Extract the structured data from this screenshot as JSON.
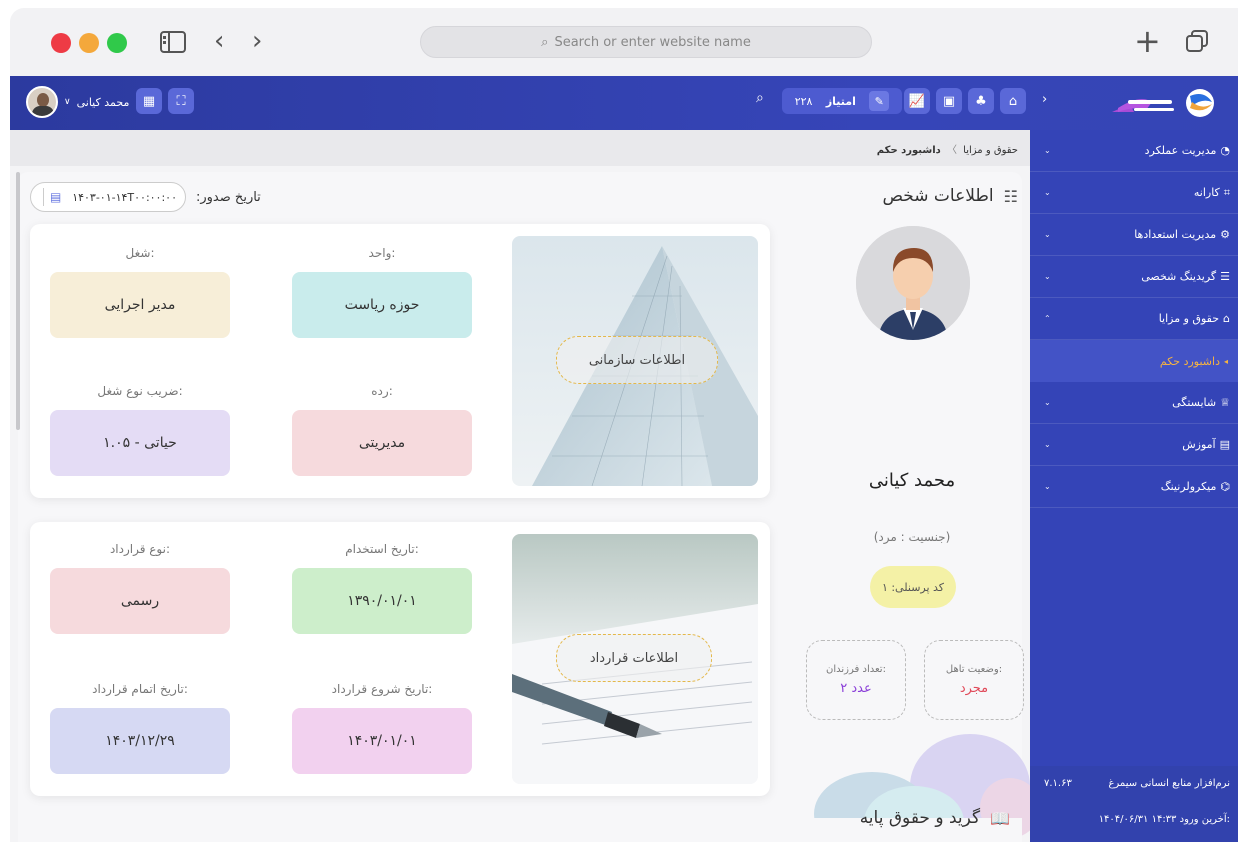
{
  "browser": {
    "address_placeholder": "Search or enter website name"
  },
  "topbar": {
    "user_name": "محمد کیانی",
    "user_chevron": "∨",
    "score_label": "امتیاز",
    "score_value": "۲۲۸"
  },
  "sidebar": {
    "items": [
      {
        "label": "مدیریت عملکرد",
        "arrow": "⌄",
        "icon": "gauge-icon"
      },
      {
        "label": "کارانه",
        "arrow": "⌄",
        "icon": "grid-icon"
      },
      {
        "label": "مدیریت استعدادها",
        "arrow": "⌄",
        "icon": "talent-icon"
      },
      {
        "label": "گریدینگ شخصی",
        "arrow": "⌄",
        "icon": "grading-icon"
      },
      {
        "label": "حقوق و مزایا",
        "arrow": "⌃",
        "icon": "salary-icon"
      },
      {
        "label": "شایستگی",
        "arrow": "⌄",
        "icon": "competency-icon"
      },
      {
        "label": "آموزش",
        "arrow": "⌄",
        "icon": "book-icon"
      },
      {
        "label": "میکرولرنینگ",
        "arrow": "⌄",
        "icon": "cap-icon"
      }
    ],
    "sub_item": "داشبورد حکم",
    "footer": {
      "product": "نرم‌افزار منابع انسانی سیمرغ",
      "version": "۷.۱.۶۳",
      "login_label": "آخرین ورود:",
      "login_value": "۱۴۰۴/۰۶/۳۱ ۱۴:۳۳"
    }
  },
  "breadcrumb": {
    "parent": "حقوق و مزایا",
    "separator": "〉",
    "current": "داشبورد حکم"
  },
  "person": {
    "section_title": "اطلاعات شخص",
    "name": "محمد کیانی",
    "gender": "(جنسیت : مرد)",
    "personnel_code": "کد پرسنلی: ۱",
    "marital_label": "وضعیت تاهل:",
    "marital_value": "مجرد",
    "children_label": "تعداد فرزندان:",
    "children_value": "۲ عدد"
  },
  "issue_date": {
    "label": "تاریخ صدور:",
    "value": "۱۴۰۳-۰۱-۱۴T۰۰:۰۰:۰۰"
  },
  "org_card": {
    "image_label": "اطلاعات سازمانی",
    "unit_label": "واحد:",
    "unit_value": "حوزه ریاست",
    "job_label": "شغل:",
    "job_value": "مدیر اجرایی",
    "rank_label": "رده:",
    "rank_value": "مدیریتی",
    "coef_label": "ضریب نوع شغل:",
    "coef_value": "حیاتی - ۱.۰۵"
  },
  "contract_card": {
    "image_label": "اطلاعات قرارداد",
    "hire_label": "تاریخ استخدام:",
    "hire_value": "۱۳۹۰/۰۱/۰۱",
    "type_label": "نوع قرارداد:",
    "type_value": "رسمی",
    "start_label": "تاریخ شروع قرارداد:",
    "start_value": "۱۴۰۳/۰۱/۰۱",
    "end_label": "تاریخ اتمام قرارداد:",
    "end_value": "۱۴۰۳/۱۲/۲۹"
  },
  "grade_section": {
    "title": "گرید و حقوق پایه"
  },
  "colors": {
    "topbar": "#3444b7",
    "unit_bg": "#c9ecec",
    "job_bg": "#f7eed8",
    "rank_bg": "#f6dadd",
    "coef_bg": "#e4dcf5",
    "hire_bg": "#cdeecb",
    "type_bg": "#f6dadd",
    "start_bg": "#f2d1ef",
    "end_bg": "#d6d9f3"
  }
}
